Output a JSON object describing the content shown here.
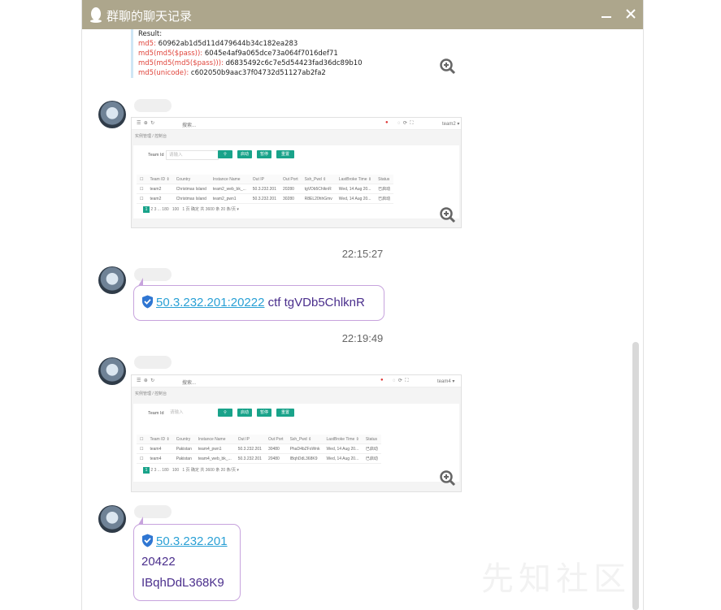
{
  "window": {
    "title": "群聊的聊天记录"
  },
  "code_block": {
    "result_label": "Result:",
    "lines": [
      {
        "key": "md5:",
        "value": "60962ab1d5d11d479644b34c182ea283"
      },
      {
        "key": "md5(md5($pass)):",
        "value": "6045e4af9a065dce73a064f7016def71"
      },
      {
        "key": "md5(md5(md5($pass))):",
        "value": "d6835492c6c7e5d54423fad36dc89b10"
      },
      {
        "key": "md5(unicode):",
        "value": "c602050b9aac37f04732d51127ab2fa2"
      }
    ]
  },
  "screenshot1": {
    "top_search": "搜索...",
    "user": "team2 ▾",
    "crumb": "实例管理 / 控制台",
    "team_id_label": "Team Id",
    "team_id_placeholder": "请输入",
    "buttons": [
      "启动",
      "暂停",
      "重置"
    ],
    "headers": [
      "Team ID ⇕",
      "Country",
      "Instance Name",
      "Out IP",
      "Out Port",
      "Ssh_Pwd ⇕",
      "LastBroke Time ⇕",
      "Status"
    ],
    "rows": [
      [
        "team2",
        "Christmas Island",
        "team2_web_bk_...",
        "50.3.232.201",
        "20280",
        "tgVDb5ChlknR",
        "Wed, 14 Aug 20...",
        "已启动"
      ],
      [
        "team2",
        "Christmas Island",
        "team2_pwn1",
        "50.3.232.201",
        "30280",
        "R8EL20hhGmv",
        "Wed, 14 Aug 20...",
        "已启动"
      ]
    ],
    "pager": [
      "1",
      "2",
      "3",
      "...",
      "180",
      "100",
      "1",
      "页",
      "确定",
      "共 3600 条",
      "20 条/页 ▾"
    ]
  },
  "time1": "22:15:27",
  "msg1": {
    "link": "50.3.232.201:20222",
    "text": " ctf tgVDb5ChlknR"
  },
  "time2": "22:19:49",
  "screenshot2": {
    "top_search": "搜索...",
    "user": "team4 ▾",
    "crumb": "实例管理 / 控制台",
    "team_id_label": "Team Id",
    "team_id_placeholder": "请输入",
    "buttons": [
      "启动",
      "暂停",
      "重置"
    ],
    "headers": [
      "Team ID ⇕",
      "Country",
      "Instance Name",
      "Out IP",
      "Out Port",
      "Ssh_Pwd ⇕",
      "LastBroke Time ⇕",
      "Status"
    ],
    "rows": [
      [
        "team4",
        "Pakistan",
        "team4_pwn1",
        "50.3.232.201",
        "30480",
        "PhaD4bZFoWnk",
        "Wed, 14 Aug 20...",
        "已启动"
      ],
      [
        "team4",
        "Pakistan",
        "team4_web_bk_...",
        "50.3.232.201",
        "20480",
        "IBqhDdL368K9",
        "Wed, 14 Aug 20...",
        "已启动"
      ]
    ],
    "pager": [
      "1",
      "2",
      "3",
      "...",
      "180",
      "100",
      "1",
      "页",
      "确定",
      "共 3600 条",
      "20 条/页 ▾"
    ]
  },
  "msg2": {
    "link": "50.3.232.201",
    "line2": "20422",
    "line3": "IBqhDdL368K9"
  },
  "watermark": "先知社区"
}
